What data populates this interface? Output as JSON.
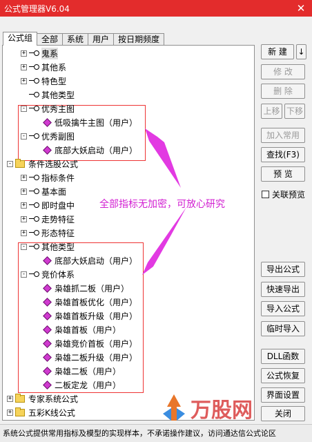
{
  "window": {
    "title": "公式管理器V6.04",
    "close_glyph": "✕"
  },
  "tabs": [
    "公式组",
    "全部",
    "系统",
    "用户",
    "按日期频度"
  ],
  "tree": [
    {
      "label": "鬼系",
      "type": "node",
      "exp": "+",
      "indent": 1,
      "hl": true
    },
    {
      "label": "其他系",
      "type": "node",
      "exp": "+",
      "indent": 1
    },
    {
      "label": "特色型",
      "type": "node",
      "exp": "+",
      "indent": 1
    },
    {
      "label": "其他类型",
      "type": "node",
      "exp": "",
      "indent": 1
    },
    {
      "label": "优秀主图",
      "type": "node",
      "exp": "-",
      "indent": 1
    },
    {
      "label": "低吸擒牛主图（用户）",
      "type": "leaf",
      "indent": 2
    },
    {
      "label": "优秀副图",
      "type": "node",
      "exp": "-",
      "indent": 1
    },
    {
      "label": "底部大妖启动（用户）",
      "type": "leaf",
      "indent": 2
    },
    {
      "label": "条件选股公式",
      "type": "folder",
      "exp": "-",
      "indent": 0
    },
    {
      "label": "指标条件",
      "type": "node",
      "exp": "+",
      "indent": 1
    },
    {
      "label": "基本面",
      "type": "node",
      "exp": "+",
      "indent": 1
    },
    {
      "label": "即时盘中",
      "type": "node",
      "exp": "+",
      "indent": 1
    },
    {
      "label": "走势特征",
      "type": "node",
      "exp": "+",
      "indent": 1
    },
    {
      "label": "形态特征",
      "type": "node",
      "exp": "+",
      "indent": 1
    },
    {
      "label": "其他类型",
      "type": "node",
      "exp": "-",
      "indent": 1
    },
    {
      "label": "底部大妖启动（用户）",
      "type": "leaf",
      "indent": 2
    },
    {
      "label": "竞价体系",
      "type": "node",
      "exp": "-",
      "indent": 1
    },
    {
      "label": "枭雄抓二板（用户）",
      "type": "leaf",
      "indent": 2
    },
    {
      "label": "枭雄首板优化（用户）",
      "type": "leaf",
      "indent": 2
    },
    {
      "label": "枭雄首板升级（用户）",
      "type": "leaf",
      "indent": 2
    },
    {
      "label": "枭雄首板（用户）",
      "type": "leaf",
      "indent": 2
    },
    {
      "label": "枭雄竞价首板（用户）",
      "type": "leaf",
      "indent": 2
    },
    {
      "label": "枭雄二板升级（用户）",
      "type": "leaf",
      "indent": 2
    },
    {
      "label": "枭雄二板（用户）",
      "type": "leaf",
      "indent": 2
    },
    {
      "label": "二板定龙（用户）",
      "type": "leaf",
      "indent": 2
    },
    {
      "label": "专家系统公式",
      "type": "folder",
      "exp": "+",
      "indent": 0
    },
    {
      "label": "五彩K线公式",
      "type": "folder",
      "exp": "+",
      "indent": 0
    }
  ],
  "buttons": {
    "new": "新 建",
    "new_arrow": "↓",
    "modify": "修 改",
    "delete": "删 除",
    "move_up": "上移",
    "move_down": "下移",
    "add_common": "加入常用",
    "find": "查找(F3)",
    "preview": "预 览",
    "linked_preview": "关联预览",
    "export": "导出公式",
    "quick_export": "快速导出",
    "import": "导入公式",
    "temp_import": "临时导入",
    "dll": "DLL函数",
    "restore": "公式恢复",
    "ui_settings": "界面设置",
    "close": "关闭"
  },
  "annotation": "全部指标无加密，可放心研究",
  "status_text": "系统公式提供常用指标及模型的实现样本，不承诺操作建议，访问通达信公式论区",
  "watermark": "万股网",
  "colors": {
    "titlebar": "#e32c2c",
    "annotation": "#d21fd2",
    "highlight_box": "#ee3333"
  }
}
